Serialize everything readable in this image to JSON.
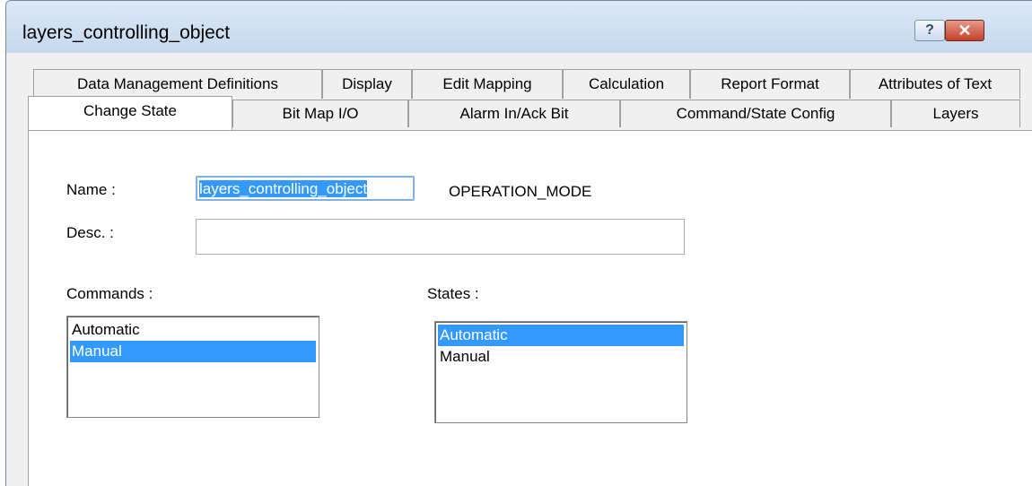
{
  "window": {
    "title": "layers_controlling_object",
    "help_label": "?",
    "close_label": "✕"
  },
  "tabs": {
    "back_row": [
      {
        "label": "Data Management Definitions"
      },
      {
        "label": "Display"
      },
      {
        "label": "Edit Mapping"
      },
      {
        "label": "Calculation"
      },
      {
        "label": "Report Format"
      },
      {
        "label": "Attributes of Text"
      }
    ],
    "front_row": [
      {
        "label": "Change State",
        "active": true
      },
      {
        "label": "Bit Map I/O"
      },
      {
        "label": "Alarm In/Ack Bit"
      },
      {
        "label": "Command/State Config"
      },
      {
        "label": "Layers"
      }
    ]
  },
  "form": {
    "name_label": "Name :",
    "name_value": "layers_controlling_object",
    "type_text": "OPERATION_MODE",
    "desc_label": "Desc. :",
    "desc_value": "",
    "commands_label": "Commands :",
    "states_label": "States :"
  },
  "commands": {
    "items": [
      {
        "label": "Automatic",
        "selected": false
      },
      {
        "label": "Manual",
        "selected": true
      }
    ]
  },
  "states": {
    "items": [
      {
        "label": "Automatic",
        "selected": true
      },
      {
        "label": "Manual",
        "selected": false
      }
    ]
  }
}
